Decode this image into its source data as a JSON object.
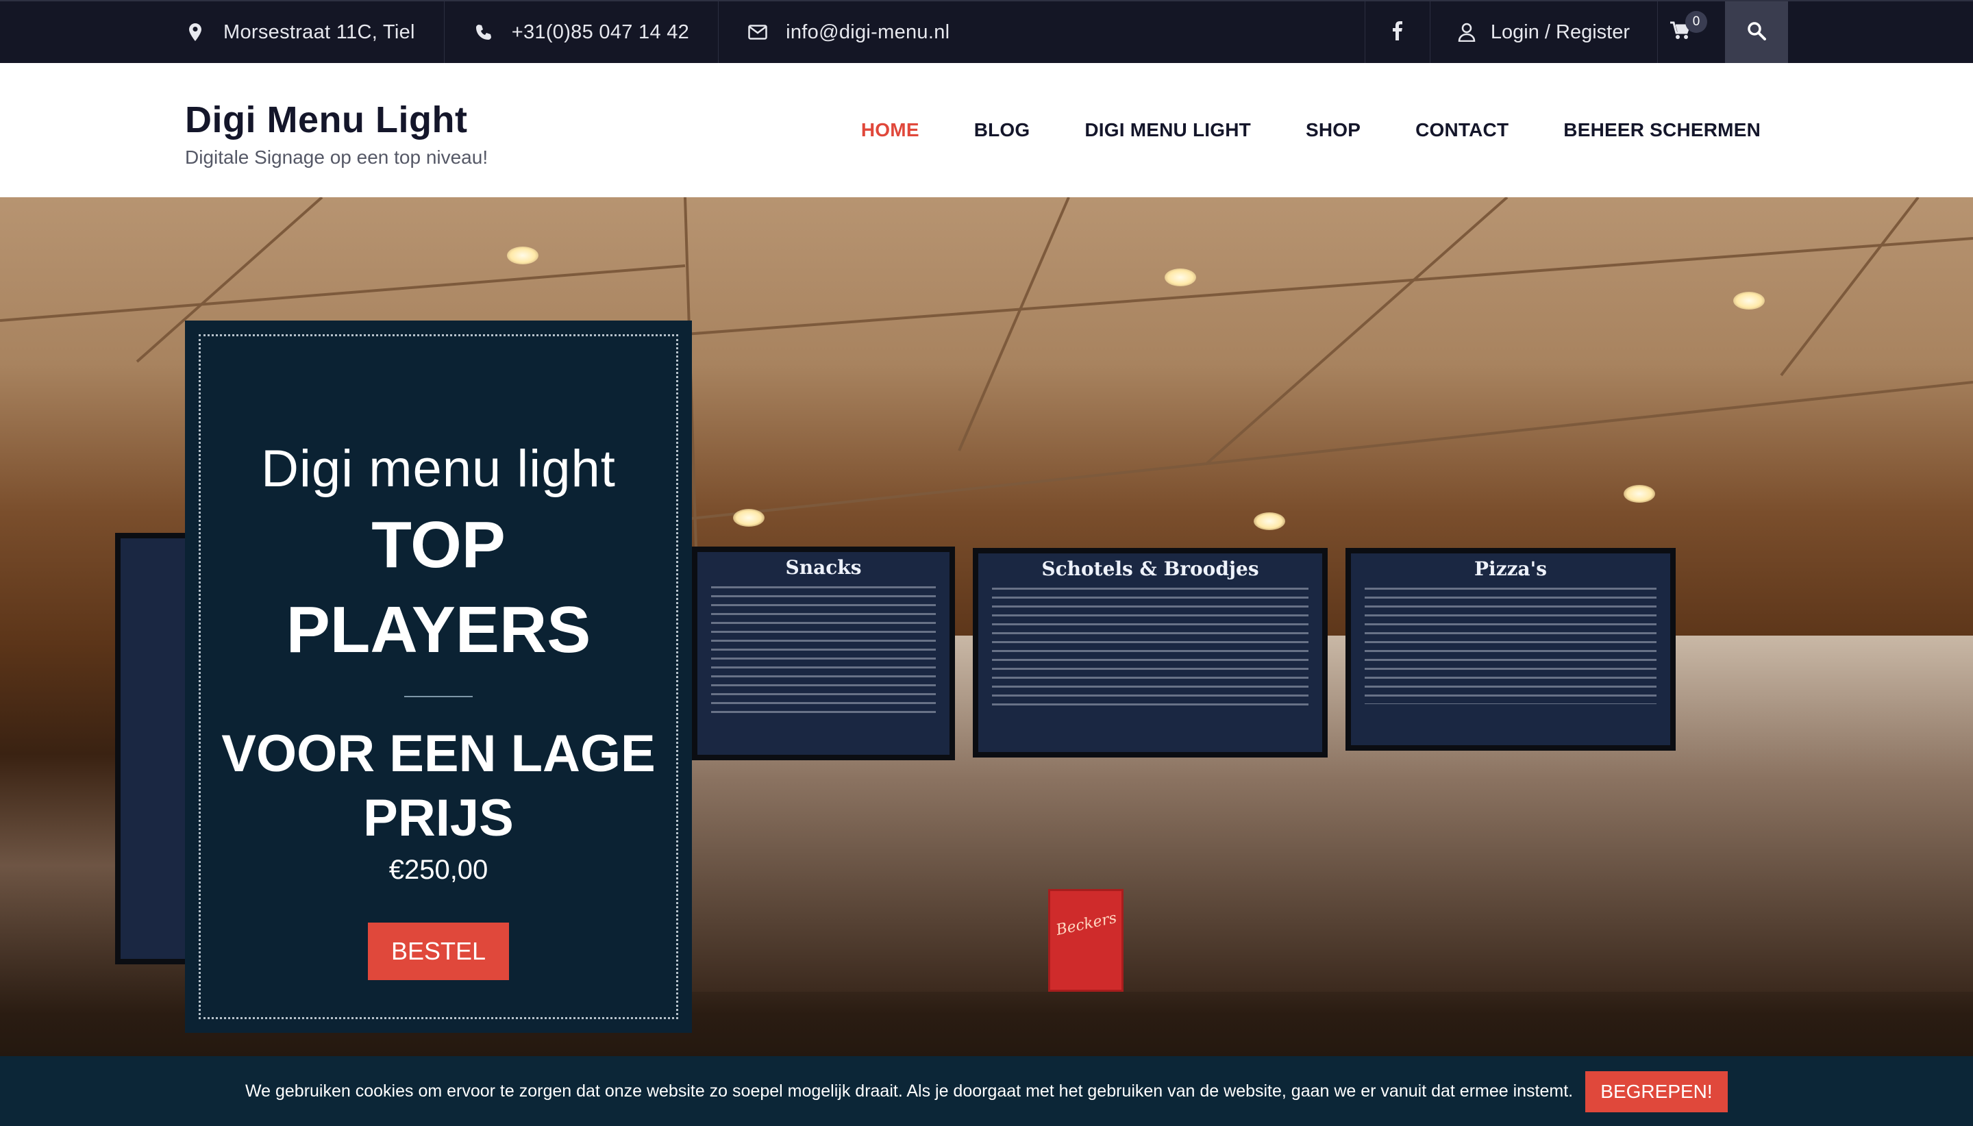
{
  "topbar": {
    "address": "Morsestraat 11C, Tiel",
    "phone": "+31(0)85 047 14 42",
    "email": "info@digi-menu.nl",
    "login": "Login / Register",
    "cart_count": "0",
    "icons": [
      "map-pin-icon",
      "phone-icon",
      "envelope-icon",
      "facebook-icon",
      "user-icon",
      "cart-icon",
      "search-icon"
    ]
  },
  "header": {
    "title": "Digi Menu Light",
    "tagline": "Digitale Signage op een top niveau!"
  },
  "nav": {
    "items": [
      {
        "label": "HOME"
      },
      {
        "label": "BLOG"
      },
      {
        "label": "DIGI MENU LIGHT"
      },
      {
        "label": "SHOP"
      },
      {
        "label": "CONTACT"
      },
      {
        "label": "BEHEER SCHERMEN"
      }
    ],
    "active": "HOME"
  },
  "hero": {
    "screens": [
      "Snacks",
      "Schotels & Broodjes",
      "Pizza's"
    ],
    "box_label": "Beckers"
  },
  "promo": {
    "kicker": "Digi menu light",
    "title_line1": "TOP",
    "title_line2": "PLAYERS",
    "sub_line1": "VOOR EEN LAGE",
    "sub_line2": "PRIJS",
    "price": "€250,00",
    "button": "BESTEL"
  },
  "cookie": {
    "text": "We gebruiken cookies om ervoor te zorgen dat onze website zo soepel mogelijk draait. Als je doorgaat met het gebruiken van de website, gaan we er vanuit dat ermee instemt.",
    "button": "BEGREPEN!"
  },
  "colors": {
    "topbar_bg": "#141625",
    "accent": "#e0483b",
    "promo_bg": "#0b2233",
    "cookie_bg": "#0c2637"
  }
}
